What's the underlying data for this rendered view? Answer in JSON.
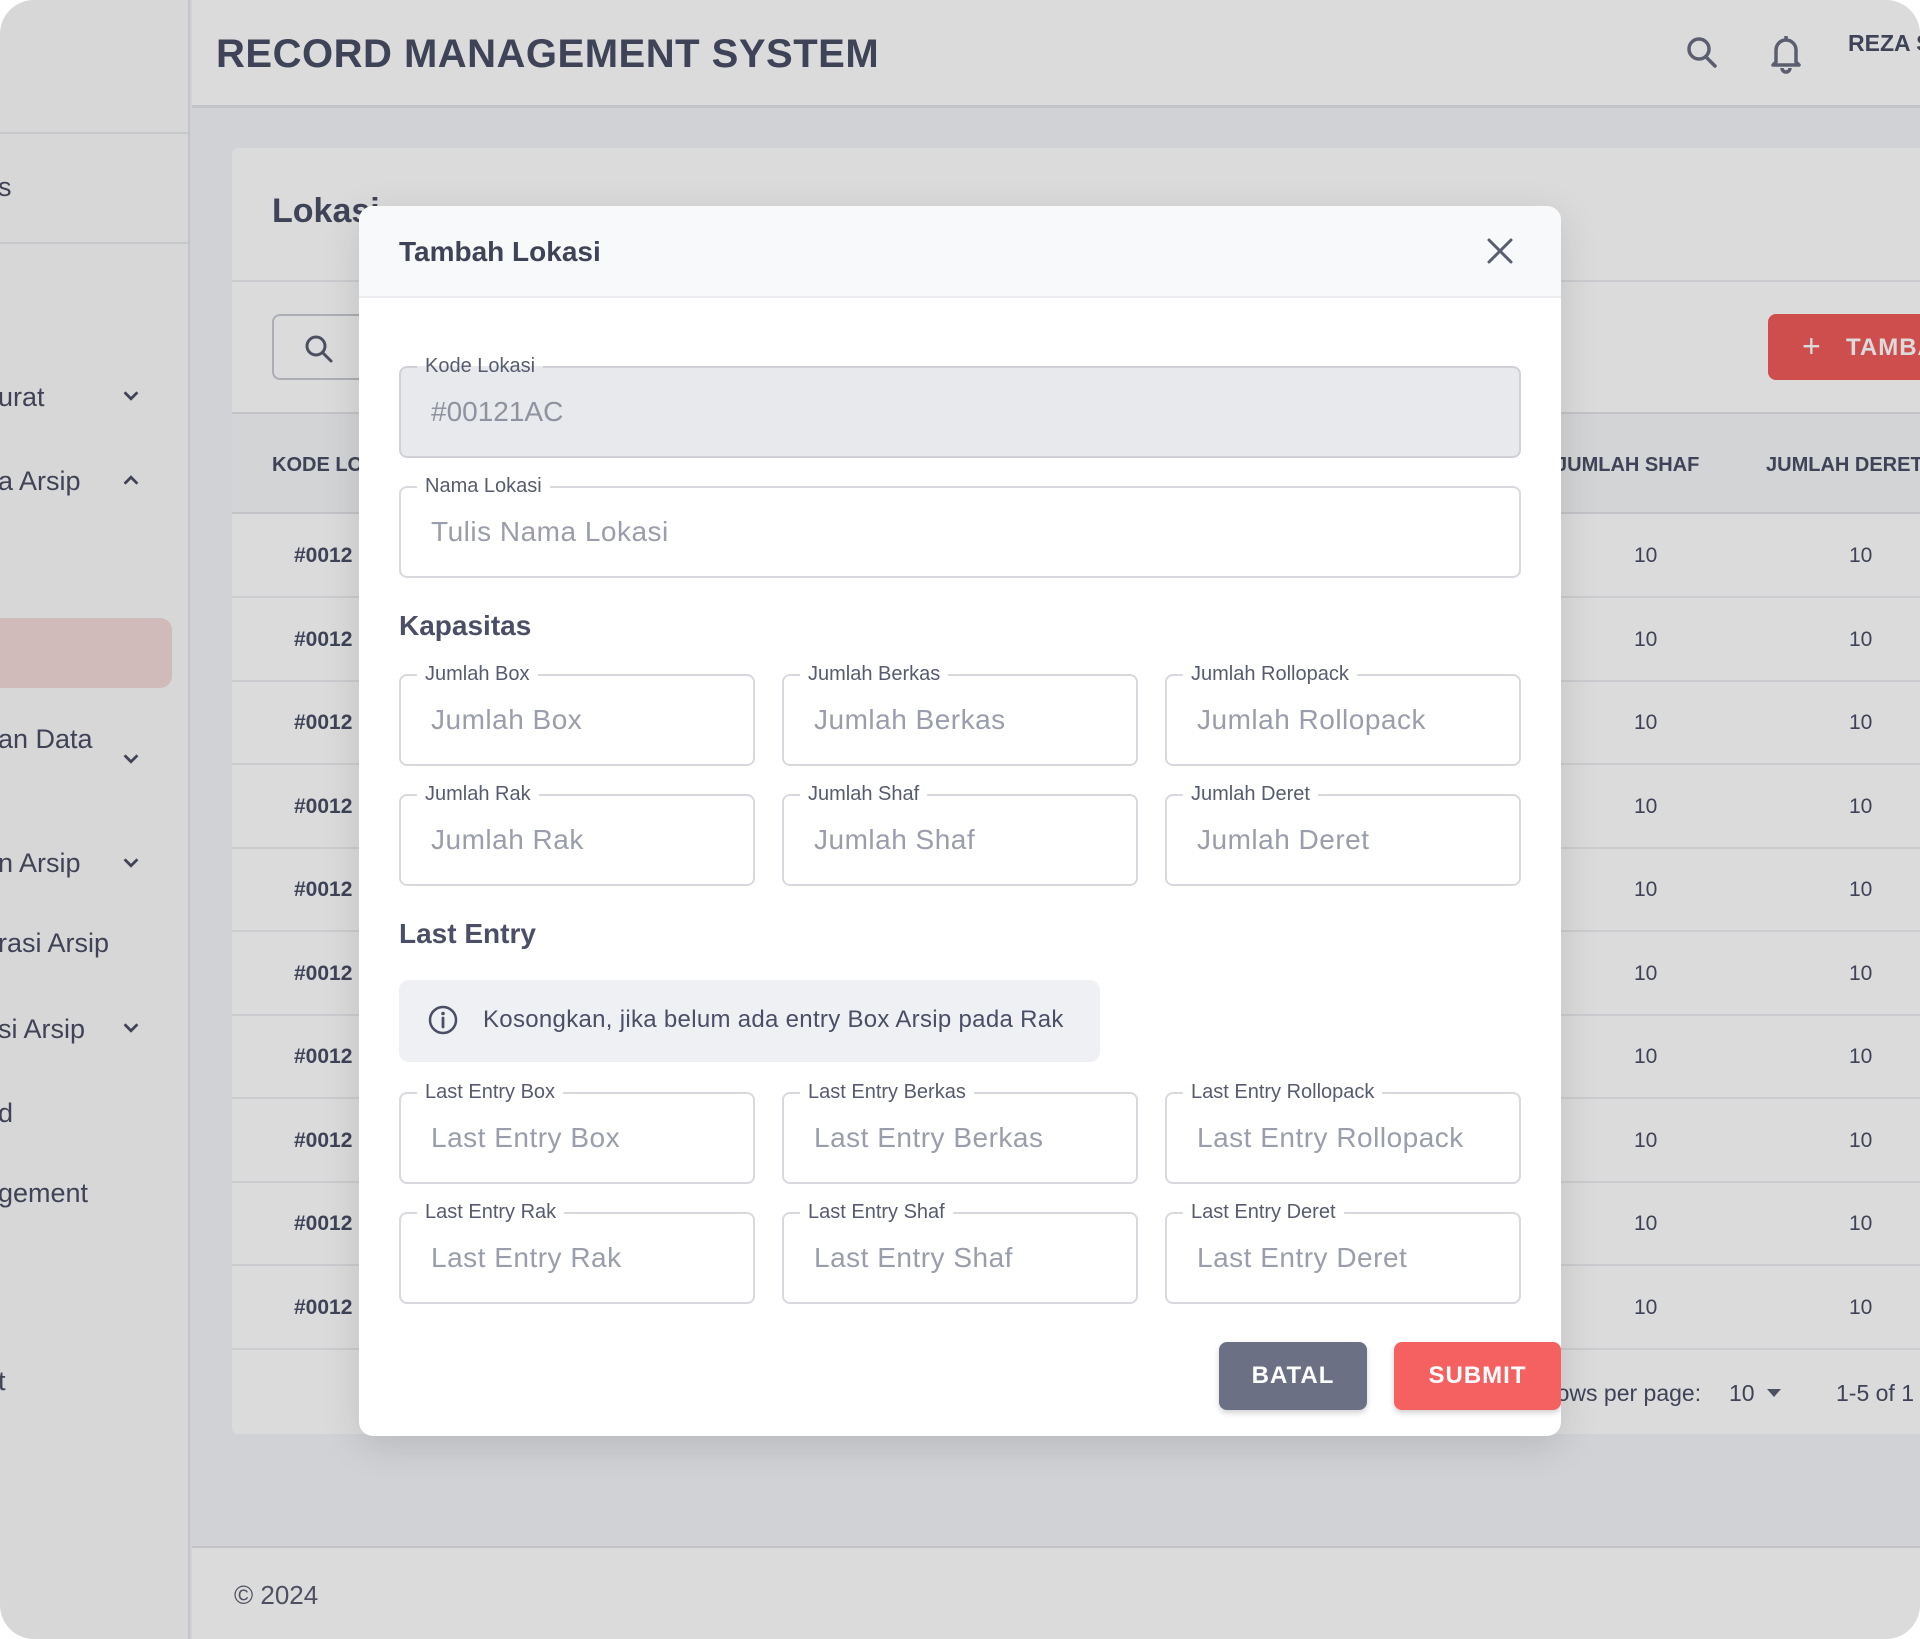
{
  "app": {
    "title": "RECORD MANAGEMENT SYSTEM",
    "user": "REZA S"
  },
  "sidebar": {
    "items": [
      {
        "label": "s"
      },
      {
        "label": "urat"
      },
      {
        "label": "a Arsip"
      },
      {
        "label": "an Data"
      },
      {
        "label": "n Arsip"
      },
      {
        "label": "rasi Arsip"
      },
      {
        "label": "si Arsip"
      },
      {
        "label": "d"
      },
      {
        "label": "gement"
      },
      {
        "label": "t"
      }
    ]
  },
  "page": {
    "title": "Lokasi",
    "add_button": "TAMBAH",
    "columns": [
      "KODE LO",
      "JUMLAH SHAF",
      "JUMLAH DERET"
    ],
    "rows": [
      {
        "code": "#0012",
        "shaf": "10",
        "deret": "10"
      },
      {
        "code": "#0012",
        "shaf": "10",
        "deret": "10"
      },
      {
        "code": "#0012",
        "shaf": "10",
        "deret": "10"
      },
      {
        "code": "#0012",
        "shaf": "10",
        "deret": "10"
      },
      {
        "code": "#0012",
        "shaf": "10",
        "deret": "10"
      },
      {
        "code": "#0012",
        "shaf": "10",
        "deret": "10"
      },
      {
        "code": "#0012",
        "shaf": "10",
        "deret": "10"
      },
      {
        "code": "#0012",
        "shaf": "10",
        "deret": "10"
      },
      {
        "code": "#0012",
        "shaf": "10",
        "deret": "10"
      },
      {
        "code": "#0012",
        "shaf": "10",
        "deret": "10"
      }
    ],
    "rows_per_page_label": "Rows per page:",
    "rows_per_page_value": "10",
    "range": "1-5 of 1"
  },
  "footer": {
    "copyright": "© 2024"
  },
  "modal": {
    "title": "Tambah Lokasi",
    "kode": {
      "label": "Kode Lokasi",
      "value": "#00121AC"
    },
    "nama": {
      "label": "Nama Lokasi",
      "placeholder": "Tulis Nama Lokasi"
    },
    "kapasitas_title": "Kapasitas",
    "kapasitas": [
      {
        "label": "Jumlah Box",
        "placeholder": "Jumlah Box"
      },
      {
        "label": "Jumlah Berkas",
        "placeholder": "Jumlah Berkas"
      },
      {
        "label": "Jumlah Rollopack",
        "placeholder": "Jumlah Rollopack"
      },
      {
        "label": "Jumlah Rak",
        "placeholder": "Jumlah Rak"
      },
      {
        "label": "Jumlah Shaf",
        "placeholder": "Jumlah Shaf"
      },
      {
        "label": "Jumlah Deret",
        "placeholder": "Jumlah Deret"
      }
    ],
    "last_entry_title": "Last Entry",
    "info_text": "Kosongkan, jika belum ada entry Box Arsip pada Rak",
    "last_entry": [
      {
        "label": "Last Entry Box",
        "placeholder": "Last Entry Box"
      },
      {
        "label": "Last Entry Berkas",
        "placeholder": "Last Entry Berkas"
      },
      {
        "label": "Last Entry Rollopack",
        "placeholder": "Last Entry Rollopack"
      },
      {
        "label": "Last Entry Rak",
        "placeholder": "Last Entry Rak"
      },
      {
        "label": "Last Entry Shaf",
        "placeholder": "Last Entry Shaf"
      },
      {
        "label": "Last Entry Deret",
        "placeholder": "Last Entry Deret"
      }
    ],
    "cancel_label": "BATAL",
    "submit_label": "SUBMIT"
  },
  "colors": {
    "accent": "#f05b5b",
    "cancel": "#6b7085",
    "text": "#4a4e66"
  }
}
